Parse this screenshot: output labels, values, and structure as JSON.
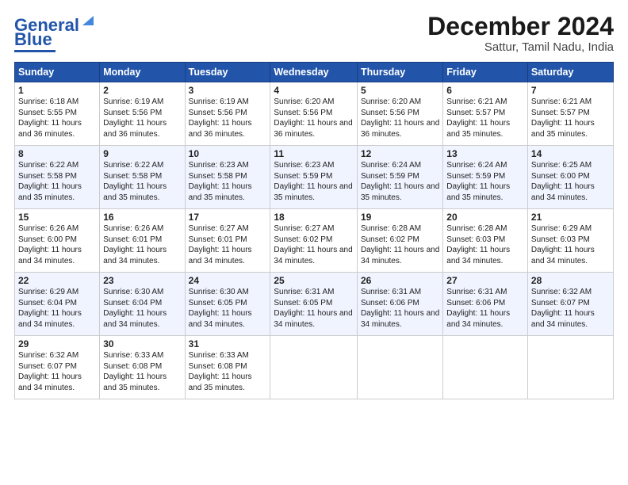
{
  "logo": {
    "line1": "General",
    "line2": "Blue"
  },
  "header": {
    "title": "December 2024",
    "subtitle": "Sattur, Tamil Nadu, India"
  },
  "days_of_week": [
    "Sunday",
    "Monday",
    "Tuesday",
    "Wednesday",
    "Thursday",
    "Friday",
    "Saturday"
  ],
  "weeks": [
    [
      {
        "day": "1",
        "sunrise": "Sunrise: 6:18 AM",
        "sunset": "Sunset: 5:55 PM",
        "daylight": "Daylight: 11 hours and 36 minutes."
      },
      {
        "day": "2",
        "sunrise": "Sunrise: 6:19 AM",
        "sunset": "Sunset: 5:56 PM",
        "daylight": "Daylight: 11 hours and 36 minutes."
      },
      {
        "day": "3",
        "sunrise": "Sunrise: 6:19 AM",
        "sunset": "Sunset: 5:56 PM",
        "daylight": "Daylight: 11 hours and 36 minutes."
      },
      {
        "day": "4",
        "sunrise": "Sunrise: 6:20 AM",
        "sunset": "Sunset: 5:56 PM",
        "daylight": "Daylight: 11 hours and 36 minutes."
      },
      {
        "day": "5",
        "sunrise": "Sunrise: 6:20 AM",
        "sunset": "Sunset: 5:56 PM",
        "daylight": "Daylight: 11 hours and 36 minutes."
      },
      {
        "day": "6",
        "sunrise": "Sunrise: 6:21 AM",
        "sunset": "Sunset: 5:57 PM",
        "daylight": "Daylight: 11 hours and 35 minutes."
      },
      {
        "day": "7",
        "sunrise": "Sunrise: 6:21 AM",
        "sunset": "Sunset: 5:57 PM",
        "daylight": "Daylight: 11 hours and 35 minutes."
      }
    ],
    [
      {
        "day": "8",
        "sunrise": "Sunrise: 6:22 AM",
        "sunset": "Sunset: 5:58 PM",
        "daylight": "Daylight: 11 hours and 35 minutes."
      },
      {
        "day": "9",
        "sunrise": "Sunrise: 6:22 AM",
        "sunset": "Sunset: 5:58 PM",
        "daylight": "Daylight: 11 hours and 35 minutes."
      },
      {
        "day": "10",
        "sunrise": "Sunrise: 6:23 AM",
        "sunset": "Sunset: 5:58 PM",
        "daylight": "Daylight: 11 hours and 35 minutes."
      },
      {
        "day": "11",
        "sunrise": "Sunrise: 6:23 AM",
        "sunset": "Sunset: 5:59 PM",
        "daylight": "Daylight: 11 hours and 35 minutes."
      },
      {
        "day": "12",
        "sunrise": "Sunrise: 6:24 AM",
        "sunset": "Sunset: 5:59 PM",
        "daylight": "Daylight: 11 hours and 35 minutes."
      },
      {
        "day": "13",
        "sunrise": "Sunrise: 6:24 AM",
        "sunset": "Sunset: 5:59 PM",
        "daylight": "Daylight: 11 hours and 35 minutes."
      },
      {
        "day": "14",
        "sunrise": "Sunrise: 6:25 AM",
        "sunset": "Sunset: 6:00 PM",
        "daylight": "Daylight: 11 hours and 34 minutes."
      }
    ],
    [
      {
        "day": "15",
        "sunrise": "Sunrise: 6:26 AM",
        "sunset": "Sunset: 6:00 PM",
        "daylight": "Daylight: 11 hours and 34 minutes."
      },
      {
        "day": "16",
        "sunrise": "Sunrise: 6:26 AM",
        "sunset": "Sunset: 6:01 PM",
        "daylight": "Daylight: 11 hours and 34 minutes."
      },
      {
        "day": "17",
        "sunrise": "Sunrise: 6:27 AM",
        "sunset": "Sunset: 6:01 PM",
        "daylight": "Daylight: 11 hours and 34 minutes."
      },
      {
        "day": "18",
        "sunrise": "Sunrise: 6:27 AM",
        "sunset": "Sunset: 6:02 PM",
        "daylight": "Daylight: 11 hours and 34 minutes."
      },
      {
        "day": "19",
        "sunrise": "Sunrise: 6:28 AM",
        "sunset": "Sunset: 6:02 PM",
        "daylight": "Daylight: 11 hours and 34 minutes."
      },
      {
        "day": "20",
        "sunrise": "Sunrise: 6:28 AM",
        "sunset": "Sunset: 6:03 PM",
        "daylight": "Daylight: 11 hours and 34 minutes."
      },
      {
        "day": "21",
        "sunrise": "Sunrise: 6:29 AM",
        "sunset": "Sunset: 6:03 PM",
        "daylight": "Daylight: 11 hours and 34 minutes."
      }
    ],
    [
      {
        "day": "22",
        "sunrise": "Sunrise: 6:29 AM",
        "sunset": "Sunset: 6:04 PM",
        "daylight": "Daylight: 11 hours and 34 minutes."
      },
      {
        "day": "23",
        "sunrise": "Sunrise: 6:30 AM",
        "sunset": "Sunset: 6:04 PM",
        "daylight": "Daylight: 11 hours and 34 minutes."
      },
      {
        "day": "24",
        "sunrise": "Sunrise: 6:30 AM",
        "sunset": "Sunset: 6:05 PM",
        "daylight": "Daylight: 11 hours and 34 minutes."
      },
      {
        "day": "25",
        "sunrise": "Sunrise: 6:31 AM",
        "sunset": "Sunset: 6:05 PM",
        "daylight": "Daylight: 11 hours and 34 minutes."
      },
      {
        "day": "26",
        "sunrise": "Sunrise: 6:31 AM",
        "sunset": "Sunset: 6:06 PM",
        "daylight": "Daylight: 11 hours and 34 minutes."
      },
      {
        "day": "27",
        "sunrise": "Sunrise: 6:31 AM",
        "sunset": "Sunset: 6:06 PM",
        "daylight": "Daylight: 11 hours and 34 minutes."
      },
      {
        "day": "28",
        "sunrise": "Sunrise: 6:32 AM",
        "sunset": "Sunset: 6:07 PM",
        "daylight": "Daylight: 11 hours and 34 minutes."
      }
    ],
    [
      {
        "day": "29",
        "sunrise": "Sunrise: 6:32 AM",
        "sunset": "Sunset: 6:07 PM",
        "daylight": "Daylight: 11 hours and 34 minutes."
      },
      {
        "day": "30",
        "sunrise": "Sunrise: 6:33 AM",
        "sunset": "Sunset: 6:08 PM",
        "daylight": "Daylight: 11 hours and 35 minutes."
      },
      {
        "day": "31",
        "sunrise": "Sunrise: 6:33 AM",
        "sunset": "Sunset: 6:08 PM",
        "daylight": "Daylight: 11 hours and 35 minutes."
      },
      null,
      null,
      null,
      null
    ]
  ]
}
